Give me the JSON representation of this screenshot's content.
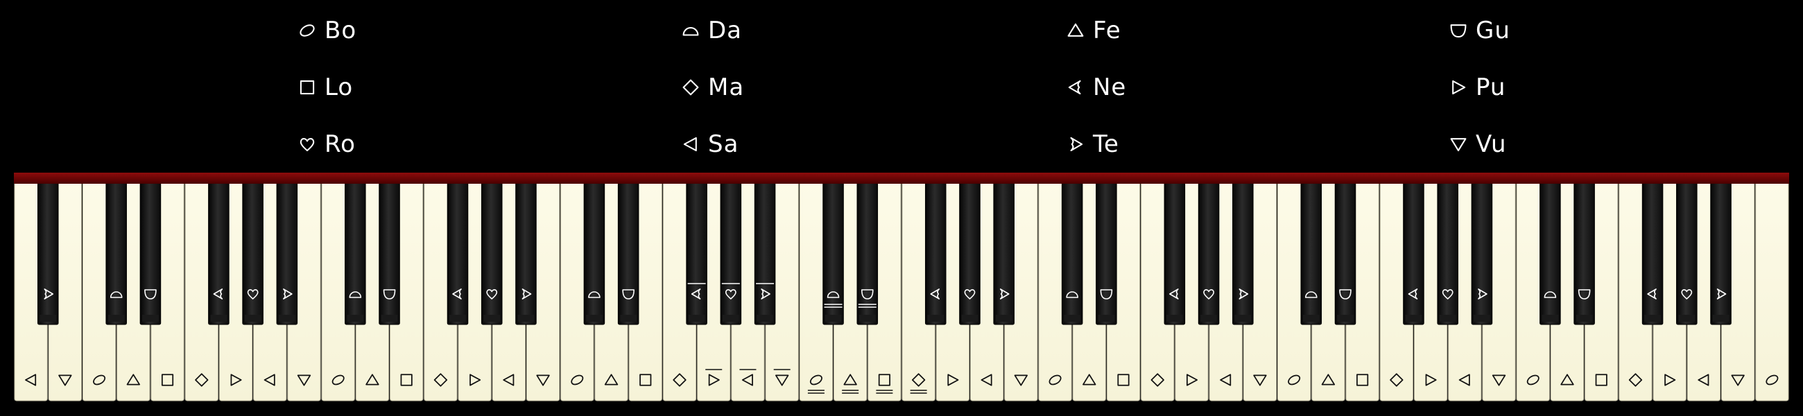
{
  "legend": [
    {
      "label": "Bo",
      "shape": "ellipse"
    },
    {
      "label": "Da",
      "shape": "semicircle"
    },
    {
      "label": "Fe",
      "shape": "triangle-up"
    },
    {
      "label": "Gu",
      "shape": "cup"
    },
    {
      "label": "Lo",
      "shape": "square"
    },
    {
      "label": "Ma",
      "shape": "diamond"
    },
    {
      "label": "Ne",
      "shape": "notched-left"
    },
    {
      "label": "Pu",
      "shape": "triangle-right"
    },
    {
      "label": "Ro",
      "shape": "heart"
    },
    {
      "label": "Sa",
      "shape": "triangle-left"
    },
    {
      "label": "Te",
      "shape": "notched-right"
    },
    {
      "label": "Vu",
      "shape": "triangle-down"
    }
  ],
  "piano": {
    "white_keys": [
      {
        "shape": "triangle-left"
      },
      {
        "shape": "triangle-down"
      },
      {
        "shape": "ellipse"
      },
      {
        "shape": "triangle-up"
      },
      {
        "shape": "square"
      },
      {
        "shape": "diamond"
      },
      {
        "shape": "triangle-right"
      },
      {
        "shape": "triangle-left"
      },
      {
        "shape": "triangle-down"
      },
      {
        "shape": "ellipse"
      },
      {
        "shape": "triangle-up"
      },
      {
        "shape": "square"
      },
      {
        "shape": "diamond"
      },
      {
        "shape": "triangle-right"
      },
      {
        "shape": "triangle-left"
      },
      {
        "shape": "triangle-down"
      },
      {
        "shape": "ellipse"
      },
      {
        "shape": "triangle-up"
      },
      {
        "shape": "square"
      },
      {
        "shape": "diamond"
      },
      {
        "shape": "triangle-right",
        "marks": [
          "over"
        ]
      },
      {
        "shape": "triangle-left",
        "marks": [
          "over"
        ]
      },
      {
        "shape": "triangle-down",
        "marks": [
          "over"
        ]
      },
      {
        "shape": "ellipse",
        "marks": [
          "under"
        ]
      },
      {
        "shape": "triangle-up",
        "marks": [
          "under"
        ]
      },
      {
        "shape": "square",
        "marks": [
          "under"
        ]
      },
      {
        "shape": "diamond",
        "marks": [
          "under"
        ]
      },
      {
        "shape": "triangle-right"
      },
      {
        "shape": "triangle-left"
      },
      {
        "shape": "triangle-down"
      },
      {
        "shape": "ellipse"
      },
      {
        "shape": "triangle-up"
      },
      {
        "shape": "square"
      },
      {
        "shape": "diamond"
      },
      {
        "shape": "triangle-right"
      },
      {
        "shape": "triangle-left"
      },
      {
        "shape": "triangle-down"
      },
      {
        "shape": "ellipse"
      },
      {
        "shape": "triangle-up"
      },
      {
        "shape": "square"
      },
      {
        "shape": "diamond"
      },
      {
        "shape": "triangle-right"
      },
      {
        "shape": "triangle-left"
      },
      {
        "shape": "triangle-down"
      },
      {
        "shape": "ellipse"
      },
      {
        "shape": "triangle-up"
      },
      {
        "shape": "square"
      },
      {
        "shape": "diamond"
      },
      {
        "shape": "triangle-right"
      },
      {
        "shape": "triangle-left"
      },
      {
        "shape": "triangle-down"
      },
      {
        "shape": "ellipse"
      }
    ],
    "black_keys": [
      {
        "shape": "notched-right"
      },
      {
        "shape": "semicircle"
      },
      {
        "shape": "cup"
      },
      {
        "shape": "notched-left"
      },
      {
        "shape": "heart"
      },
      {
        "shape": "notched-right"
      },
      {
        "shape": "semicircle"
      },
      {
        "shape": "cup"
      },
      {
        "shape": "notched-left"
      },
      {
        "shape": "heart"
      },
      {
        "shape": "notched-right"
      },
      {
        "shape": "semicircle"
      },
      {
        "shape": "cup"
      },
      {
        "shape": "notched-left",
        "marks": [
          "over"
        ]
      },
      {
        "shape": "heart",
        "marks": [
          "over"
        ]
      },
      {
        "shape": "notched-right",
        "marks": [
          "over"
        ]
      },
      {
        "shape": "semicircle",
        "marks": [
          "under"
        ]
      },
      {
        "shape": "cup",
        "marks": [
          "under"
        ]
      },
      {
        "shape": "notched-left"
      },
      {
        "shape": "heart"
      },
      {
        "shape": "notched-right"
      },
      {
        "shape": "semicircle"
      },
      {
        "shape": "cup"
      },
      {
        "shape": "notched-left"
      },
      {
        "shape": "heart"
      },
      {
        "shape": "notched-right"
      },
      {
        "shape": "semicircle"
      },
      {
        "shape": "cup"
      },
      {
        "shape": "notched-left"
      },
      {
        "shape": "heart"
      },
      {
        "shape": "notched-right"
      },
      {
        "shape": "semicircle"
      },
      {
        "shape": "cup"
      },
      {
        "shape": "notched-left"
      },
      {
        "shape": "heart"
      },
      {
        "shape": "notched-right"
      }
    ]
  }
}
